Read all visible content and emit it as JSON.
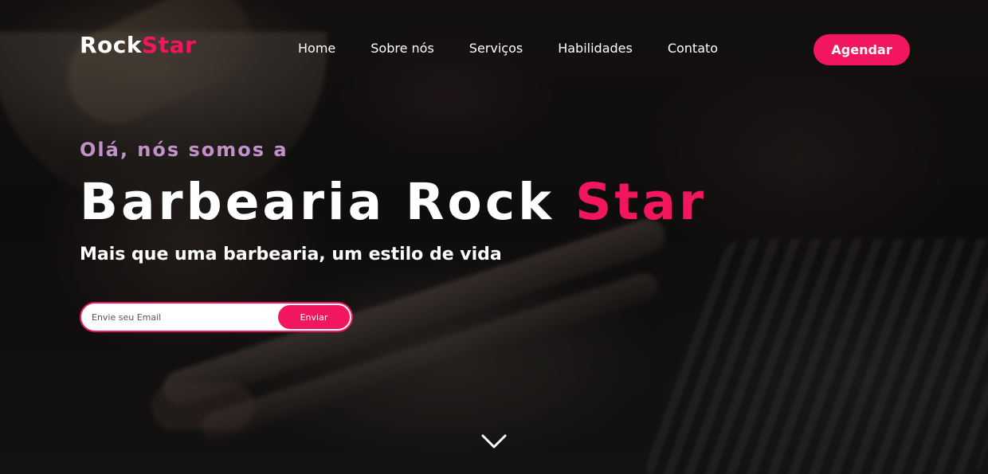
{
  "brand": {
    "name_part1": "Rock",
    "name_part2": "Star",
    "accent_color": "#f2165e"
  },
  "nav": {
    "items": [
      {
        "label": "Home"
      },
      {
        "label": "Sobre nós"
      },
      {
        "label": "Serviços"
      },
      {
        "label": "Habilidades"
      },
      {
        "label": "Contato"
      }
    ],
    "cta_label": "Agendar"
  },
  "hero": {
    "intro": "Olá, nós somos a",
    "title_part1": "Barbearia Rock ",
    "title_part2": "Star",
    "subtitle": "Mais que uma barbearia, um estilo de vida",
    "email_placeholder": "Envie seu Email",
    "send_label": "Enviar",
    "intro_color": "#c191c8",
    "scroll_icon": "chevron-down-icon"
  }
}
